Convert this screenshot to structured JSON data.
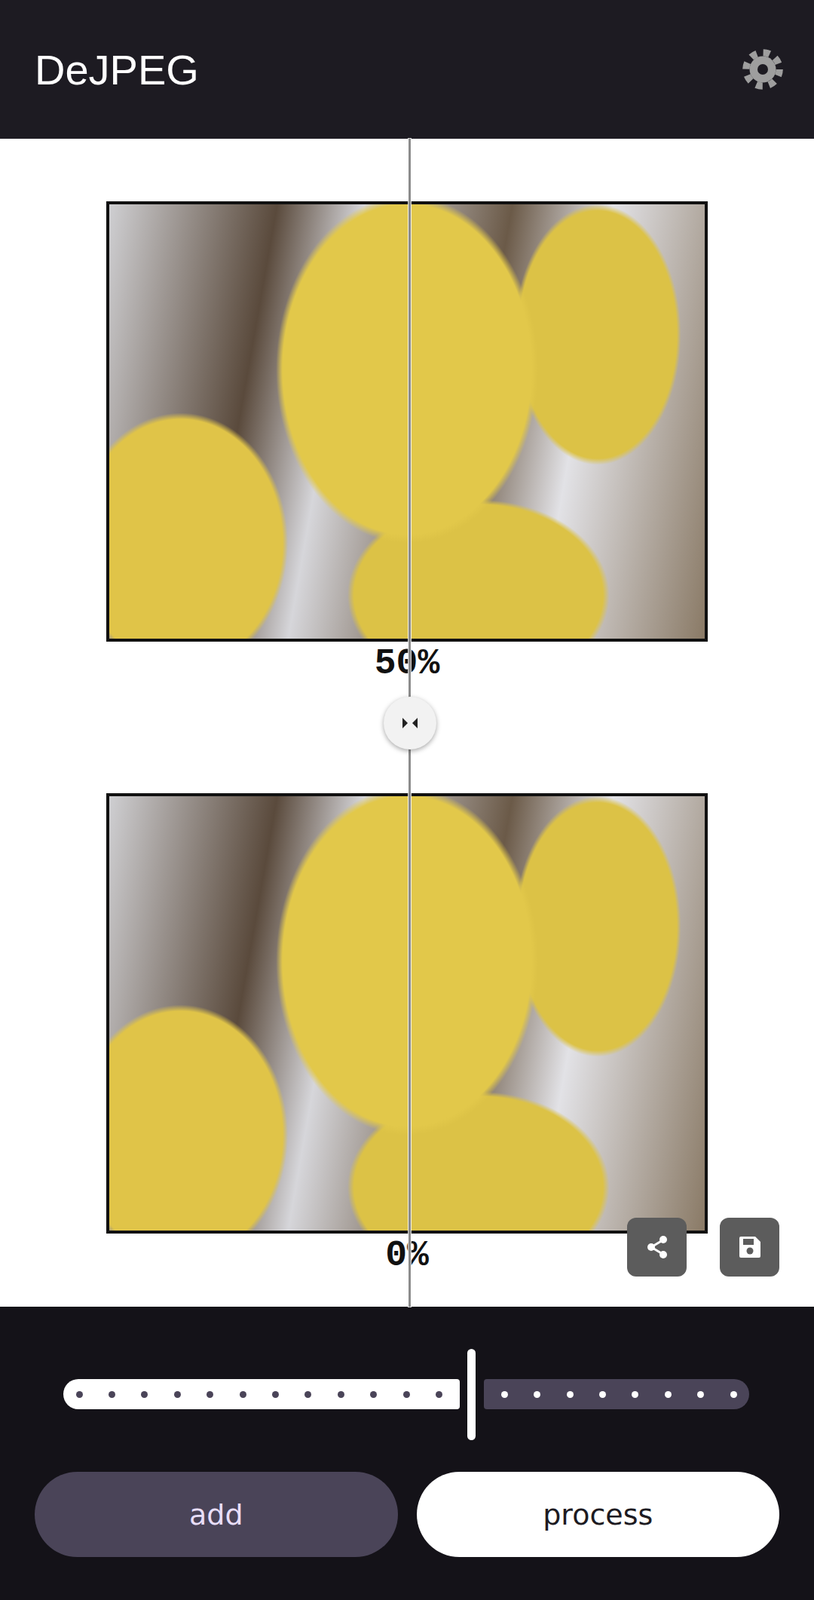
{
  "app_bar": {
    "title": "DeJPEG"
  },
  "compare": {
    "level": 0.505
  },
  "previews": [
    {
      "label": "50%"
    },
    {
      "label": "0%"
    }
  ],
  "slider": {
    "level": 0.6,
    "steps": 20
  },
  "buttons": [
    {
      "label": "add",
      "kind": "tonal"
    },
    {
      "label": "process",
      "kind": "filled"
    }
  ]
}
